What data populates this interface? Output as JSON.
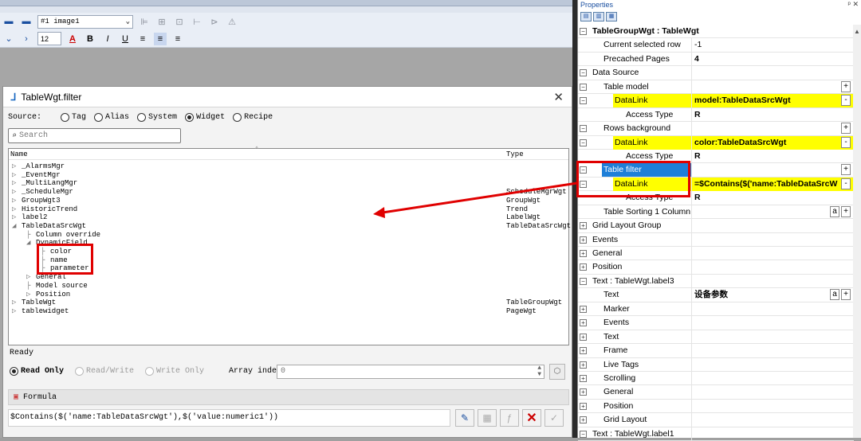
{
  "toolbar": {
    "image_select": "#1 image1",
    "font_size": "12",
    "bold": "B",
    "italic": "I",
    "underline": "U"
  },
  "dialog": {
    "title": "TableWgt.filter",
    "source_label": "Source:",
    "source_options": [
      "Tag",
      "Alias",
      "System",
      "Widget",
      "Recipe"
    ],
    "source_selected": "Widget",
    "search_placeholder": "Search",
    "columns": {
      "name": "Name",
      "type": "Type"
    },
    "rows": [
      {
        "indent": 0,
        "arrow": "▷",
        "name": "_AlarmsMgr",
        "type": ""
      },
      {
        "indent": 0,
        "arrow": "▷",
        "name": "_EventMgr",
        "type": ""
      },
      {
        "indent": 0,
        "arrow": "▷",
        "name": "_MultiLangMgr",
        "type": ""
      },
      {
        "indent": 0,
        "arrow": "▷",
        "name": "_ScheduleMgr",
        "type": "ScheduleMgrWgt"
      },
      {
        "indent": 0,
        "arrow": "▷",
        "name": "GroupWgt3",
        "type": "GroupWgt"
      },
      {
        "indent": 0,
        "arrow": "▷",
        "name": "HistoricTrend",
        "type": "Trend"
      },
      {
        "indent": 0,
        "arrow": "▷",
        "name": "label2",
        "type": "LabelWgt"
      },
      {
        "indent": 0,
        "arrow": "◢",
        "name": "TableDataSrcWgt",
        "type": "TableDataSrcWgt"
      },
      {
        "indent": 1,
        "arrow": "",
        "name": "Column override",
        "type": ""
      },
      {
        "indent": 1,
        "arrow": "◢",
        "name": "DynamicField",
        "type": ""
      },
      {
        "indent": 2,
        "arrow": "",
        "name": "color",
        "type": ""
      },
      {
        "indent": 2,
        "arrow": "",
        "name": "name",
        "type": ""
      },
      {
        "indent": 2,
        "arrow": "",
        "name": "parameter",
        "type": ""
      },
      {
        "indent": 1,
        "arrow": "▷",
        "name": "General",
        "type": ""
      },
      {
        "indent": 1,
        "arrow": "",
        "name": "Model source",
        "type": ""
      },
      {
        "indent": 1,
        "arrow": "▷",
        "name": "Position",
        "type": ""
      },
      {
        "indent": 0,
        "arrow": "▷",
        "name": "TableWgt",
        "type": "TableGroupWgt"
      },
      {
        "indent": 0,
        "arrow": "▷",
        "name": "tablewidget",
        "type": "PageWgt"
      }
    ],
    "status": "Ready",
    "access_options": [
      "Read Only",
      "Read/Write",
      "Write Only"
    ],
    "access_selected": "Read Only",
    "array_index_label": "Array index",
    "array_index_value": "0",
    "formula_label": "Formula",
    "formula_value": "$Contains($('name:TableDataSrcWgt'),$('value:numeric1'))"
  },
  "properties": {
    "panel_title": "Properties",
    "rows": [
      {
        "level": 0,
        "exp": "⊟",
        "label": "TableGroupWgt : TableWgt",
        "value": "",
        "header": true
      },
      {
        "level": 1,
        "exp": "",
        "label": "Current selected row",
        "value": "-1"
      },
      {
        "level": 1,
        "exp": "",
        "label": "Precached Pages",
        "value": "4",
        "bold": true
      },
      {
        "level": 0,
        "exp": "⊟",
        "label": "Data Source",
        "value": ""
      },
      {
        "level": 1,
        "exp": "⊟",
        "label": "Table model",
        "value": "",
        "btn": "+"
      },
      {
        "level": 2,
        "exp": "⊟",
        "label": "DataLink",
        "value": "model:TableDataSrcWgt",
        "bold": true,
        "yellow": true,
        "btn": "-"
      },
      {
        "level": 3,
        "exp": "",
        "label": "Access Type",
        "value": "R",
        "bold": true
      },
      {
        "level": 1,
        "exp": "⊟",
        "label": "Rows background",
        "value": "",
        "btn": "+"
      },
      {
        "level": 2,
        "exp": "⊟",
        "label": "DataLink",
        "value": "color:TableDataSrcWgt",
        "bold": true,
        "yellow": true,
        "btn": "-"
      },
      {
        "level": 3,
        "exp": "",
        "label": "Access Type",
        "value": "R",
        "bold": true
      },
      {
        "level": 1,
        "exp": "⊟",
        "label": "Table filter",
        "value": "",
        "btn": "+",
        "selected": true
      },
      {
        "level": 2,
        "exp": "⊟",
        "label": "DataLink",
        "value": "=$Contains($('name:TableDataSrcW",
        "bold": true,
        "yellow": true,
        "btn": "-"
      },
      {
        "level": 3,
        "exp": "",
        "label": "Access Type",
        "value": "R",
        "bold": true
      },
      {
        "level": 1,
        "exp": "",
        "label": "Table Sorting 1 Column",
        "value": "",
        "btn": "+",
        "btn2": "a"
      },
      {
        "level": 0,
        "exp": "⊞",
        "label": "Grid Layout Group",
        "value": ""
      },
      {
        "level": 0,
        "exp": "⊞",
        "label": "Events",
        "value": ""
      },
      {
        "level": 0,
        "exp": "⊞",
        "label": "General",
        "value": ""
      },
      {
        "level": 0,
        "exp": "⊞",
        "label": "Position",
        "value": ""
      },
      {
        "level": 0,
        "exp": "⊟",
        "label": "Text : TableWgt.label3",
        "value": ""
      },
      {
        "level": 1,
        "exp": "",
        "label": "Text",
        "value": "设备参数",
        "bold": true,
        "btn": "+",
        "btn2": "a"
      },
      {
        "level": 1,
        "exp": "⊞",
        "label": "Marker",
        "value": ""
      },
      {
        "level": 1,
        "exp": "⊞",
        "label": "Events",
        "value": ""
      },
      {
        "level": 1,
        "exp": "⊞",
        "label": "Text",
        "value": ""
      },
      {
        "level": 1,
        "exp": "⊞",
        "label": "Frame",
        "value": ""
      },
      {
        "level": 1,
        "exp": "⊞",
        "label": "Live Tags",
        "value": ""
      },
      {
        "level": 1,
        "exp": "⊞",
        "label": "Scrolling",
        "value": ""
      },
      {
        "level": 1,
        "exp": "⊞",
        "label": "General",
        "value": ""
      },
      {
        "level": 1,
        "exp": "⊞",
        "label": "Position",
        "value": ""
      },
      {
        "level": 1,
        "exp": "⊞",
        "label": "Grid Layout",
        "value": ""
      },
      {
        "level": 0,
        "exp": "⊟",
        "label": "Text : TableWgt.label1",
        "value": ""
      }
    ]
  }
}
